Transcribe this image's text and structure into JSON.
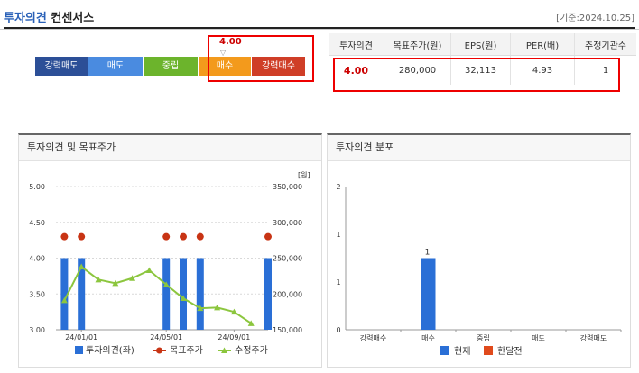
{
  "header": {
    "title_main": "투자의견",
    "title_sub": "컨센서스",
    "date": "[기준:2024.10.25]"
  },
  "opinion_scale": {
    "labels": [
      "강력매도",
      "매도",
      "중립",
      "매수",
      "강력매수"
    ],
    "colors": [
      "#2c4f97",
      "#4a8be0",
      "#6cb42c",
      "#f39a1c",
      "#cf3e27"
    ],
    "marker_value": "4.00",
    "marker_symbol": "▽"
  },
  "consensus_table": {
    "headers": [
      "투자의견",
      "목표주가(원)",
      "EPS(원)",
      "PER(배)",
      "추정기관수"
    ],
    "row": [
      "4.00",
      "280,000",
      "32,113",
      "4.93",
      "1"
    ]
  },
  "panel_left": {
    "title": "투자의견 및 목표주가",
    "unit": "[원]",
    "legend": [
      "투자의견(좌)",
      "목표주가",
      "수정주가"
    ]
  },
  "panel_right": {
    "title": "투자의견 분포",
    "legend": [
      "현재",
      "한달전"
    ]
  },
  "chart_data": [
    {
      "type": "bar+line",
      "left_axis": {
        "ticks": [
          "5.00",
          "4.50",
          "4.00",
          "3.50",
          "3.00"
        ],
        "range": [
          3.0,
          5.0
        ]
      },
      "right_axis": {
        "ticks": [
          "350,000",
          "300,000",
          "250,000",
          "200,000",
          "150,000"
        ],
        "range": [
          150000,
          350000
        ]
      },
      "x_ticks": [
        "24/01/01",
        "24/05/01",
        "24/09/01"
      ],
      "x_tick_index": [
        1,
        6,
        10
      ],
      "series": [
        {
          "name": "투자의견(좌)",
          "kind": "bar",
          "color": "#2a6fd6",
          "points": [
            [
              0,
              4.0
            ],
            [
              1,
              4.0
            ],
            [
              6,
              4.0
            ],
            [
              7,
              4.0
            ],
            [
              8,
              4.0
            ],
            [
              12,
              4.0
            ]
          ]
        },
        {
          "name": "목표주가",
          "kind": "dot",
          "color": "#c83414",
          "points": [
            [
              0,
              280000
            ],
            [
              1,
              280000
            ],
            [
              6,
              280000
            ],
            [
              7,
              280000
            ],
            [
              8,
              280000
            ],
            [
              12,
              280000
            ]
          ]
        },
        {
          "name": "수정주가",
          "kind": "line",
          "color": "#8cc63e",
          "values": [
            191000,
            238000,
            220000,
            215000,
            222000,
            233000,
            213000,
            194000,
            180000,
            181000,
            175000,
            159000
          ]
        }
      ],
      "period_count": 12.5
    },
    {
      "type": "bar",
      "categories": [
        "강력매수",
        "매수",
        "중립",
        "매도",
        "강력매도"
      ],
      "series": [
        {
          "name": "현재",
          "color": "#2a6fd6",
          "values": [
            0,
            1,
            0,
            0,
            0
          ]
        },
        {
          "name": "한달전",
          "color": "#e04a1c",
          "values": [
            0,
            0,
            0,
            0,
            0
          ]
        }
      ],
      "ylim": [
        0,
        2
      ],
      "y_ticks": [
        "2",
        "1",
        "1",
        "0"
      ],
      "value_labels": [
        "",
        "1",
        "",
        "",
        ""
      ]
    }
  ]
}
